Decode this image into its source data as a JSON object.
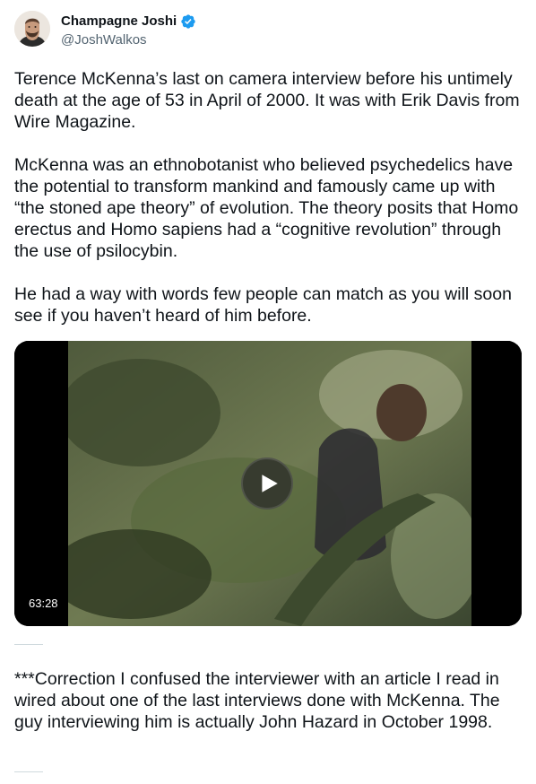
{
  "author": {
    "name": "Champagne Joshi",
    "handle": "@JoshWalkos",
    "verified_color": "#1d9bf0",
    "avatar_icon": "bearded-man-avatar"
  },
  "tweet": {
    "paragraphs": [
      "Terence McKenna’s last on camera interview before his untimely death at the age of 53 in April of 2000. It was with Erik Davis from Wire Magazine.",
      "McKenna was an ethnobotanist who believed psychedelics have the potential to transform mankind and famously came up with “the stoned ape theory” of evolution. The theory posits that Homo erectus and Homo sapiens had a “cognitive revolution” through the use of psilocybin.",
      "He had a way with words few people can match as you will soon see if you haven’t heard of him before."
    ]
  },
  "video": {
    "duration": "63:28",
    "play_icon": "play-icon"
  },
  "reply": {
    "text": "***Correction I confused the interviewer with an article I read in wired about one of the last interviews done with McKenna. The guy interviewing him is actually John Hazard in October 1998."
  }
}
